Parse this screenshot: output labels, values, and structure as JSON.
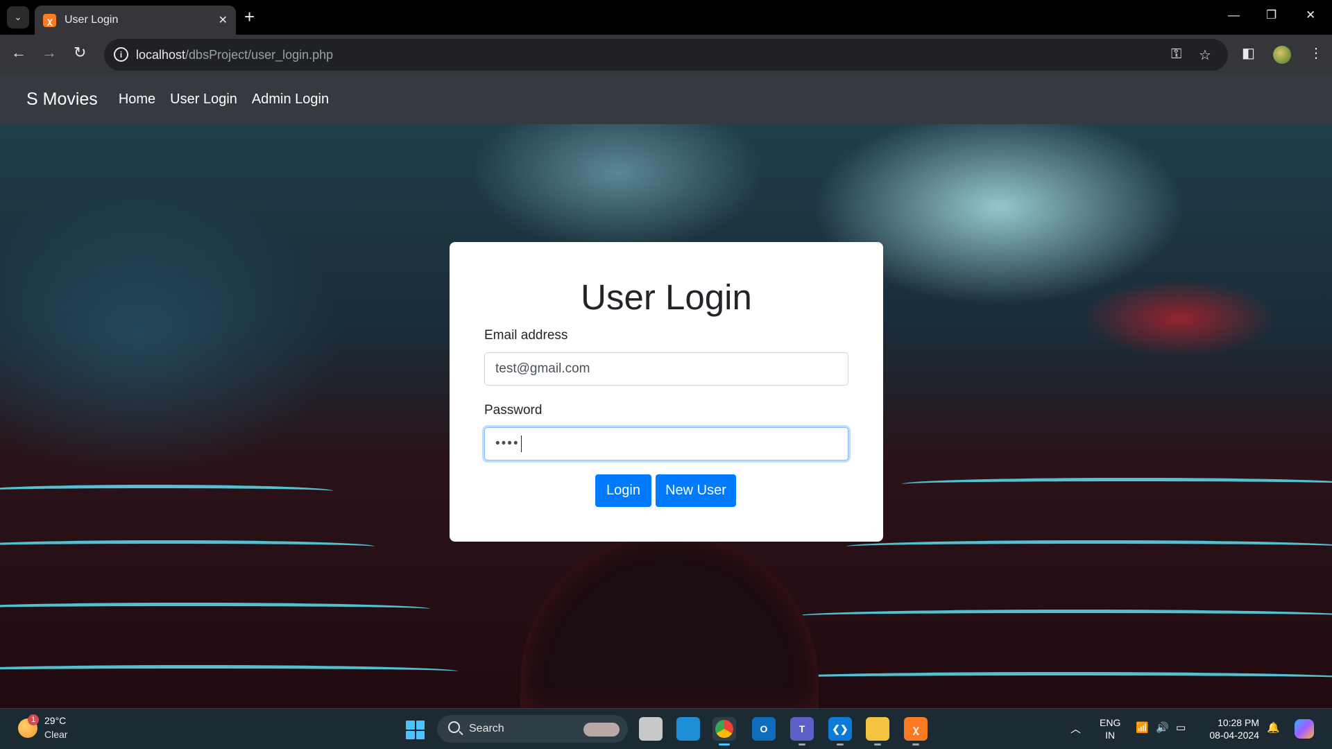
{
  "browser": {
    "tab_title": "User Login",
    "url_host": "localhost",
    "url_path": "/dbsProject/user_login.php",
    "tab_list_icon": "chevron-down-icon",
    "new_tab_glyph": "+"
  },
  "navbar": {
    "brand": "S Movies",
    "links": [
      "Home",
      "User Login",
      "Admin Login"
    ]
  },
  "login": {
    "title": "User Login",
    "email_label": "Email address",
    "email_value": "test@gmail.com",
    "password_label": "Password",
    "password_masked": "••••",
    "login_button": "Login",
    "new_user_button": "New User"
  },
  "taskbar": {
    "weather_temp": "29°C",
    "weather_condition": "Clear",
    "weather_badge": "1",
    "search_label": "Search",
    "lang_line1": "ENG",
    "lang_line2": "IN",
    "time": "10:28 PM",
    "date": "08-04-2024"
  },
  "colors": {
    "navbar_bg": "#343a40",
    "primary": "#007bff",
    "card_bg": "#ffffff"
  }
}
